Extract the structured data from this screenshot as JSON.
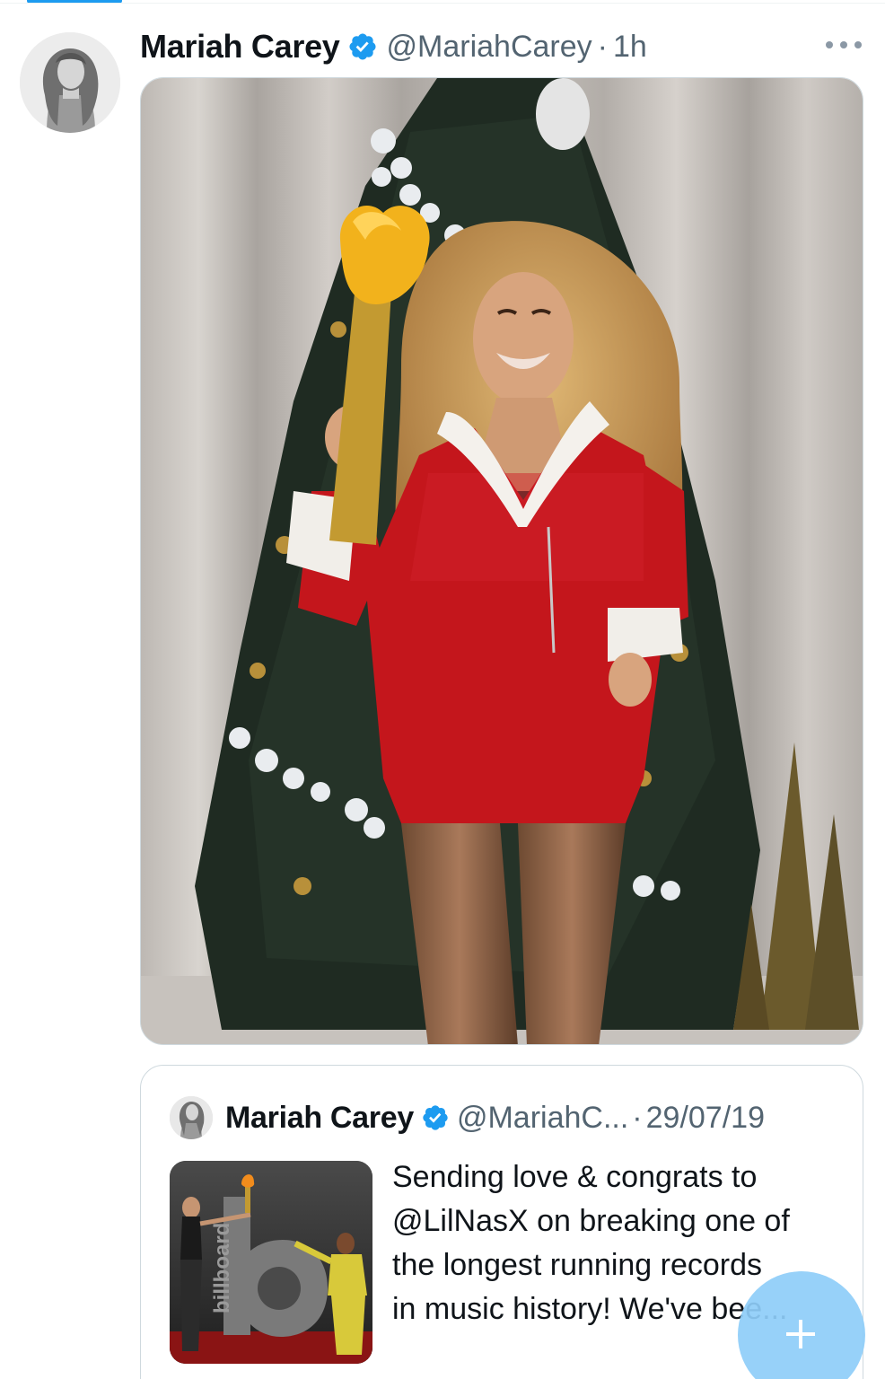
{
  "tweet": {
    "display_name": "Mariah Carey",
    "handle": "@MariahCarey",
    "separator": "·",
    "time": "1h",
    "media_alt": "Photo of Mariah Carey in a red sequin Santa romper holding a golden torch in front of a Christmas tree"
  },
  "quote": {
    "display_name": "Mariah Carey",
    "handle": "@MariahC...",
    "separator": "·",
    "date": "29/07/19",
    "text_lines": [
      "Sending love & congrats to",
      "@LilNasX on breaking one of",
      "the longest running records",
      "in music history! We've bee..."
    ],
    "thumb_logo": "billboard"
  },
  "icons": {
    "verified": "verified-badge-icon",
    "more": "more-horizontal-icon",
    "compose": "plus-icon"
  },
  "colors": {
    "accent": "#1d9bf0",
    "fab": "#8ecdf8",
    "secondary_text": "#536471"
  }
}
